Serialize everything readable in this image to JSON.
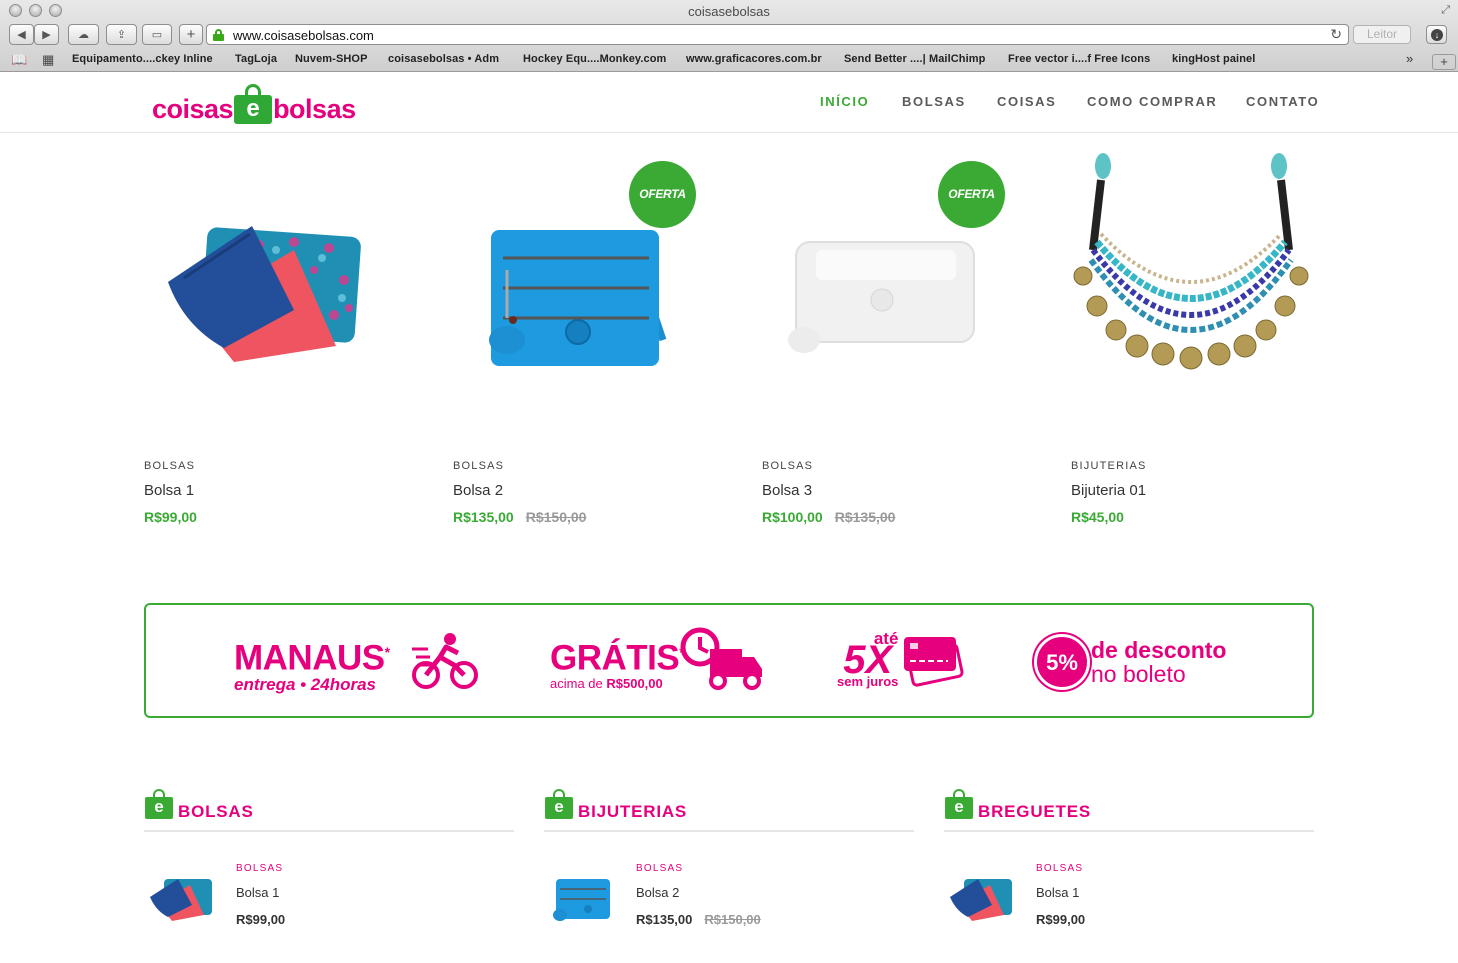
{
  "browser": {
    "window_title": "coisasebolsas",
    "url": "www.coisasebolsas.com",
    "reader_label": "Leitor",
    "bookmarks": [
      "Equipamento....ckey Inline",
      "TagLoja",
      "Nuvem-SHOP",
      "coisasebolsas • Adm",
      "Hockey Equ....Monkey.com",
      "www.graficacores.com.br",
      "Send Better ....| MailChimp",
      "Free vector i....f Free Icons",
      "kingHost painel"
    ]
  },
  "site": {
    "logo": {
      "left": "coisas",
      "bag_letter": "e",
      "right": "bolsas"
    },
    "nav": [
      "INÍCIO",
      "BOLSAS",
      "COISAS",
      "COMO COMPRAR",
      "CONTATO"
    ],
    "colors": {
      "brand_pink": "#e6007e",
      "brand_green": "#3aaa35"
    }
  },
  "products": [
    {
      "category": "BOLSAS",
      "name": "Bolsa 1",
      "price": "R$99,00",
      "old_price": "",
      "badge": "",
      "image": "pouch-set"
    },
    {
      "category": "BOLSAS",
      "name": "Bolsa 2",
      "price": "R$135,00",
      "old_price": "R$150,00",
      "badge": "OFERTA",
      "image": "blue-crossbody-bag"
    },
    {
      "category": "BOLSAS",
      "name": "Bolsa 3",
      "price": "R$100,00",
      "old_price": "R$135,00",
      "badge": "OFERTA",
      "image": "white-bag"
    },
    {
      "category": "BIJUTERIAS",
      "name": "Bijuteria 01",
      "price": "R$45,00",
      "old_price": "",
      "badge": "",
      "image": "necklace"
    }
  ],
  "banner": {
    "manaus": {
      "title": "MANAUS",
      "asterisk": "*",
      "subtitle": "entrega • 24horas",
      "icon": "cyclist-icon"
    },
    "gratis": {
      "title": "GRÁTIS",
      "asterisk": "*",
      "subtitle_prefix": "acima de",
      "subtitle_value": "R$500,00",
      "icon": "delivery-truck-icon"
    },
    "installments": {
      "upto": "até",
      "times": "5X",
      "subtitle": "sem juros",
      "icon": "credit-card-icon"
    },
    "discount": {
      "percent": "5%",
      "line1": "de desconto",
      "line2": "no boleto"
    }
  },
  "sections": [
    {
      "title": "BOLSAS",
      "item": {
        "category": "BOLSAS",
        "name": "Bolsa 1",
        "price": "R$99,00",
        "old_price": "",
        "image": "pouch-set"
      }
    },
    {
      "title": "BIJUTERIAS",
      "item": {
        "category": "BOLSAS",
        "name": "Bolsa 2",
        "price": "R$135,00",
        "old_price": "R$150,00",
        "image": "blue-crossbody-bag"
      }
    },
    {
      "title": "BREGUETES",
      "item": {
        "category": "BOLSAS",
        "name": "Bolsa 1",
        "price": "R$99,00",
        "old_price": "",
        "image": "pouch-set"
      }
    }
  ]
}
